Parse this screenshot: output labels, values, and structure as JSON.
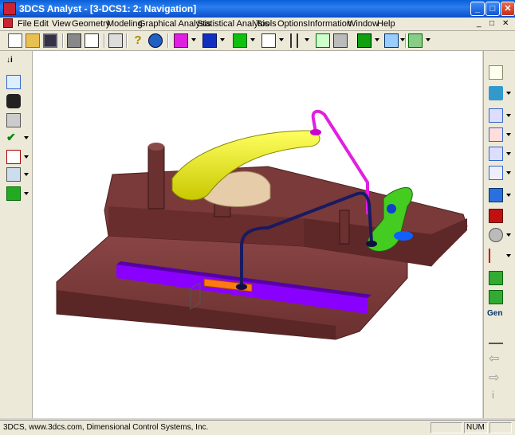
{
  "window": {
    "title": "3DCS Analyst - [3-DCS1: 2: Navigation]",
    "buttons": {
      "minimize": "_",
      "maximize": "□",
      "close": "✕"
    }
  },
  "menu": {
    "items": [
      "File",
      "Edit",
      "View",
      "Geometry",
      "Modeling",
      "Graphical Analysis",
      "Statistical Analysis",
      "Tools",
      "Options",
      "Information",
      "Window",
      "Help"
    ],
    "mdi_buttons": [
      "_",
      "□",
      "✕"
    ]
  },
  "toolbar": {
    "icons": [
      "new-icon",
      "open-icon",
      "save-icon",
      "print-icon",
      "print-preview-icon",
      "copy-icon",
      "help-icon",
      "about-icon",
      "cube-magenta-icon",
      "cube-blue-icon",
      "cube-green-icon",
      "cube-wire-icon",
      "parallel-icon",
      "network-icon",
      "merge-icon",
      "cube-assembly-icon",
      "move-icon",
      "lattice-icon"
    ]
  },
  "left_toolbar": {
    "icons": [
      "info-icon",
      "doc-icon",
      "binoculars-icon",
      "tools-icon",
      "checkmark-icon",
      "log-lib-icon",
      "log-icon",
      "excel-icon"
    ]
  },
  "right_toolbar": {
    "icons": [
      "eye-icon",
      "point-icon",
      "feature-icon",
      "move-point-icon",
      "target-icon",
      "grid-icon",
      "cube-icon",
      "red-blocks-icon",
      "sphere-icon",
      "axis-icon",
      "house-icon",
      "house-up-icon"
    ],
    "gen_label": "Gen",
    "bottom_icons": [
      "balance-icon",
      "arrow-left-icon",
      "arrow-right-icon",
      "info-small-icon"
    ]
  },
  "status": {
    "text": "3DCS, www.3dcs.com, Dimensional Control Systems, Inc.",
    "num": "NUM"
  },
  "colors": {
    "title_bar": "#0a5fd8",
    "model_base": "#6b3030",
    "clamp": "#e8e800",
    "rail": "#8a00ff"
  }
}
